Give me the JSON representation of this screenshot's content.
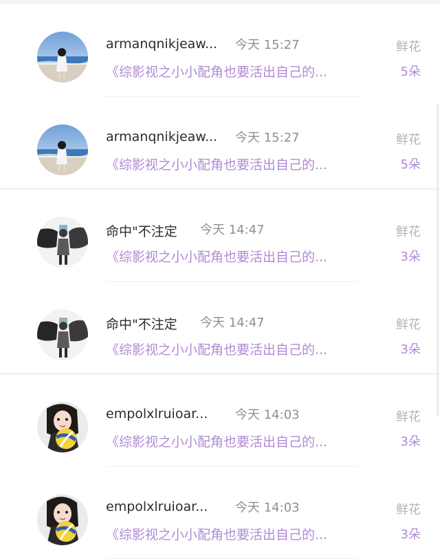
{
  "notifications": [
    {
      "name": "armanqnikjeaw...",
      "time": "今天 15:27",
      "type": "鲜花",
      "book": "《综影视之小小配角也要活出自己的...",
      "count": "5朵",
      "avatar": "beach-avatar-icon"
    },
    {
      "name": "armanqnikjeaw...",
      "time": "今天 15:27",
      "type": "鲜花",
      "book": "《综影视之小小配角也要活出自己的...",
      "count": "5朵",
      "avatar": "beach-avatar-icon"
    },
    {
      "name": "命中\"不注定",
      "time": "今天 14:47",
      "type": "鲜花",
      "book": "《综影视之小小配角也要活出自己的...",
      "count": "3朵",
      "avatar": "ink-figure-avatar-icon"
    },
    {
      "name": "命中\"不注定",
      "time": "今天 14:47",
      "type": "鲜花",
      "book": "《综影视之小小配角也要活出自己的...",
      "count": "3朵",
      "avatar": "ink-figure-avatar-icon"
    },
    {
      "name": "empolxlruioar...",
      "time": "今天 14:03",
      "type": "鲜花",
      "book": "《综影视之小小配角也要活出自己的...",
      "count": "3朵",
      "avatar": "girl-volleyball-avatar-icon"
    },
    {
      "name": "empolxlruioar...",
      "time": "今天 14:03",
      "type": "鲜花",
      "book": "《综影视之小小配角也要活出自己的...",
      "count": "3朵",
      "avatar": "girl-volleyball-avatar-icon"
    }
  ]
}
